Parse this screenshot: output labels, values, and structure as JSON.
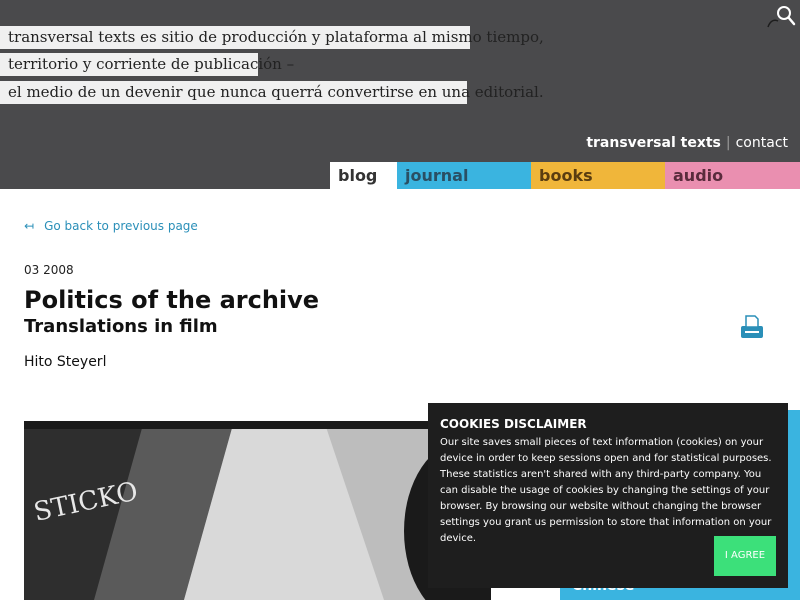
{
  "header": {
    "tagline_lines": [
      "transversal texts es sitio de producción y plataforma al mismo tiempo,",
      "territorio y corriente de publicación –",
      "el medio de un devenir que nunca querrá convertirse en una editorial."
    ],
    "search_icon": "search-icon",
    "top_links": {
      "brand": "transversal texts",
      "separator": "|",
      "contact": "contact"
    },
    "nav": [
      {
        "label": "blog",
        "color": "#ffffff"
      },
      {
        "label": "journal",
        "color": "#3ab4e0"
      },
      {
        "label": "books",
        "color": "#f0b63a"
      },
      {
        "label": "audio",
        "color": "#ea8fb0"
      }
    ]
  },
  "article": {
    "back_arrow": "↤",
    "back_label": "Go back to previous page",
    "date": "03 2008",
    "title": "Politics of the archive",
    "subtitle": "Translations in film",
    "author": "Hito Steyerl",
    "print_icon": "print-icon",
    "image_caption": "",
    "image_overlay_text": "STICKO"
  },
  "side_panel": {
    "visible_language": "Chinese"
  },
  "cookies": {
    "title": "COOKIES DISCLAIMER",
    "text": "Our site saves small pieces of text information (cookies) on your device in order to keep sessions open and for statistical purposes. These statistics aren't shared with any third-party company. You can disable the usage of cookies by changing the settings of your browser. By browsing our website without changing the browser settings you grant us permission to store that information on your device.",
    "agree_label": "I AGREE"
  },
  "colors": {
    "header_bg": "#4a4a4c",
    "accent_link": "#2a8fb8",
    "agree_button": "#3ce07a",
    "cookie_bg": "#1e1e1e"
  }
}
